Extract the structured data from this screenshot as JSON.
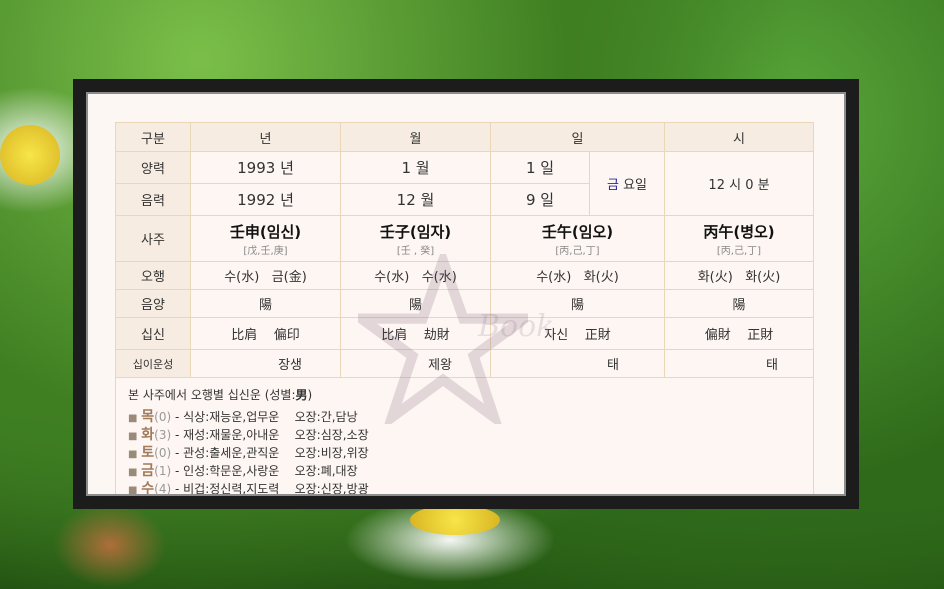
{
  "table": {
    "headers": [
      "구분",
      "년",
      "월",
      "일",
      "시"
    ],
    "solar": {
      "label": "양력",
      "year": "1993 년",
      "month": "1 월",
      "day": "1 일"
    },
    "lunar": {
      "label": "음력",
      "year": "1992 년",
      "month": "12 월",
      "day": "9 일"
    },
    "weekday": {
      "char": "금",
      "suffix": "요일"
    },
    "time": "12 시 0 분",
    "saju": {
      "label": "사주",
      "pillars": [
        {
          "name": "壬申(임신)",
          "hidden": "[戊,壬,庚]"
        },
        {
          "name": "壬子(임자)",
          "hidden": "[壬 , 癸]"
        },
        {
          "name": "壬午(임오)",
          "hidden": "[丙,己,丁]"
        },
        {
          "name": "丙午(병오)",
          "hidden": "[丙,己,丁]"
        }
      ]
    },
    "ohaeng": {
      "label": "오행",
      "values": [
        [
          "수(水)",
          "금(金)"
        ],
        [
          "수(水)",
          "수(水)"
        ],
        [
          "수(水)",
          "화(火)"
        ],
        [
          "화(火)",
          "화(火)"
        ]
      ]
    },
    "eumyang": {
      "label": "음양",
      "values": [
        "陽",
        "陽",
        "陽",
        "陽"
      ]
    },
    "sipsin": {
      "label": "십신",
      "values": [
        [
          "比肩",
          "偏印"
        ],
        [
          "比肩",
          "劫財"
        ],
        [
          "자신",
          "正財"
        ],
        [
          "偏財",
          "正財"
        ]
      ]
    },
    "unseong": {
      "label": "십이운성",
      "values": [
        "장생",
        "제왕",
        "태",
        "태"
      ]
    }
  },
  "summary": {
    "title_prefix": "본 사주에서 오행별 십신운 (성별:",
    "gender": "男",
    "title_suffix": ")",
    "items": [
      {
        "element": "목",
        "count": "(0)",
        "desc": " - 식상:재능운,업무운",
        "organs": "오장:간,담낭"
      },
      {
        "element": "화",
        "count": "(3)",
        "desc": " - 재성:재물운,아내운",
        "organs": "오장:심장,소장"
      },
      {
        "element": "토",
        "count": "(0)",
        "desc": " - 관성:출세운,관직운",
        "organs": "오장:비장,위장"
      },
      {
        "element": "금",
        "count": "(1)",
        "desc": " - 인성:학문운,사랑운",
        "organs": "오장:폐,대장"
      },
      {
        "element": "수",
        "count": "(4)",
        "desc": " - 비겁:정신력,지도력",
        "organs": "오장:신장,방광"
      }
    ]
  },
  "watermark": {
    "text": "Book"
  },
  "colors": {
    "frame": "#1c1c1c",
    "panel": "#fcf7f3",
    "border": "#ead7b8",
    "header": "#f6ece1",
    "weekday": "#2a2aa0"
  }
}
